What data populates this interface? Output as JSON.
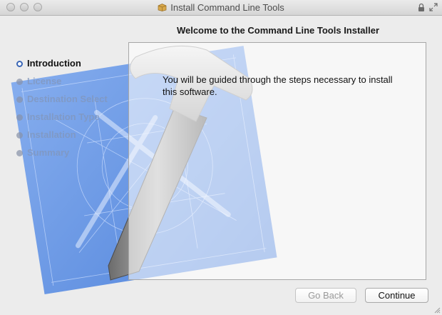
{
  "window": {
    "title": "Install Command Line Tools"
  },
  "header": {
    "heading": "Welcome to the Command Line Tools Installer"
  },
  "steps": [
    {
      "label": "Introduction",
      "active": true
    },
    {
      "label": "License",
      "active": false
    },
    {
      "label": "Destination Select",
      "active": false
    },
    {
      "label": "Installation Type",
      "active": false
    },
    {
      "label": "Installation",
      "active": false
    },
    {
      "label": "Summary",
      "active": false
    }
  ],
  "content": {
    "text": "You will be guided through the steps necessary to install this software."
  },
  "buttons": {
    "back": "Go Back",
    "continue": "Continue"
  },
  "icons": {
    "title": "package-icon",
    "lock": "lock-icon",
    "fullscreen": "fullscreen-icon"
  },
  "colors": {
    "blueprint": "#4f86e0",
    "active_step_dot": "#3a66b6"
  }
}
